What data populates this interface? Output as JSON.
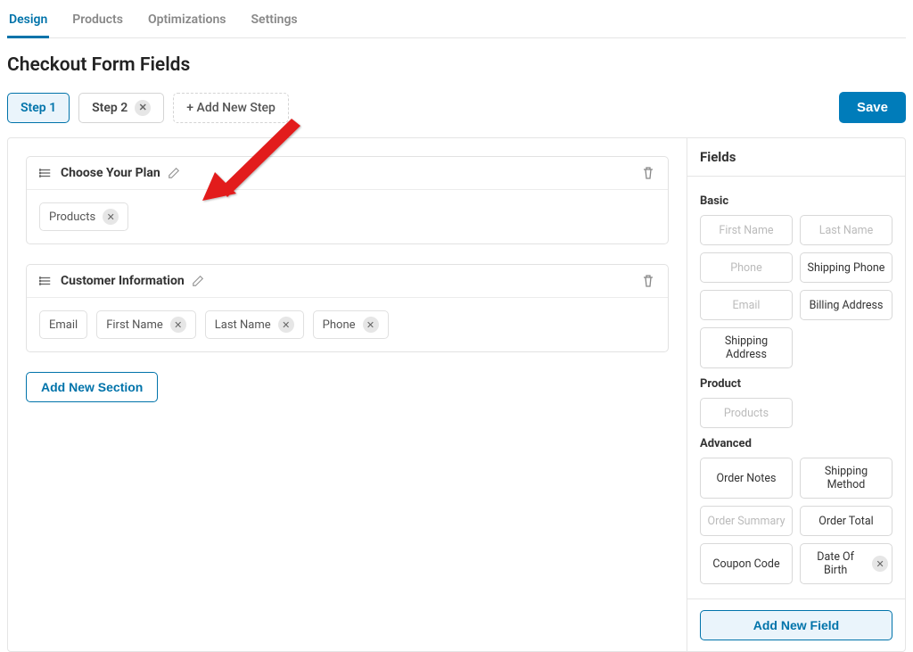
{
  "tabs": {
    "design": "Design",
    "products": "Products",
    "optimizations": "Optimizations",
    "settings": "Settings"
  },
  "page_title": "Checkout Form Fields",
  "steps": {
    "step1": "Step 1",
    "step2": "Step 2",
    "add": "+ Add New Step"
  },
  "save_label": "Save",
  "sections": {
    "plan_title": "Choose Your Plan",
    "plan_fields": {
      "products": "Products"
    },
    "customer_title": "Customer Information",
    "customer_fields": {
      "email": "Email",
      "first_name": "First Name",
      "last_name": "Last Name",
      "phone": "Phone"
    }
  },
  "add_section_label": "Add New Section",
  "sidebar": {
    "title": "Fields",
    "groups": {
      "basic": {
        "label": "Basic",
        "first_name": "First Name",
        "last_name": "Last Name",
        "phone": "Phone",
        "shipping_phone": "Shipping Phone",
        "email": "Email",
        "billing_address": "Billing Address",
        "shipping_address": "Shipping Address"
      },
      "product": {
        "label": "Product",
        "products": "Products"
      },
      "advanced": {
        "label": "Advanced",
        "order_notes": "Order Notes",
        "shipping_method": "Shipping Method",
        "order_summary": "Order Summary",
        "order_total": "Order Total",
        "coupon_code": "Coupon Code",
        "date_of_birth": "Date Of Birth"
      }
    },
    "add_field_label": "Add New Field"
  }
}
